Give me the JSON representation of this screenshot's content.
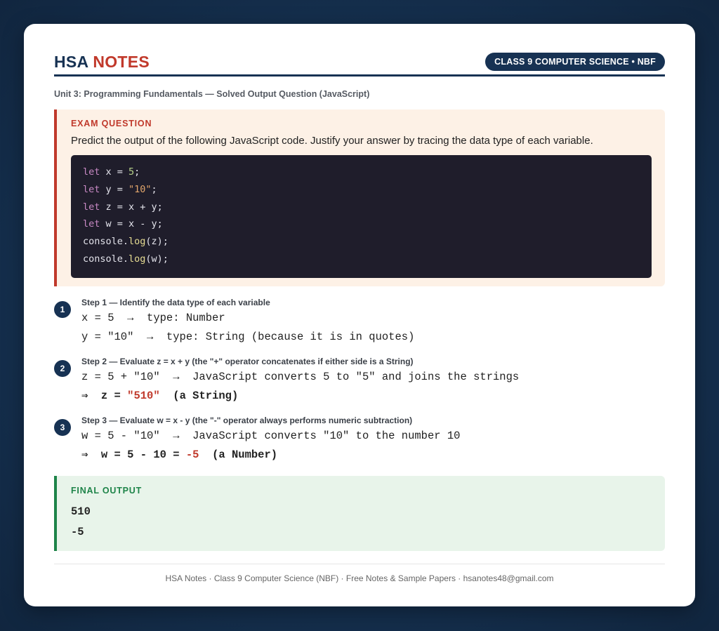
{
  "header": {
    "brand_part1": "HSA",
    "brand_part2": "NOTES",
    "badge": "CLASS 9 COMPUTER SCIENCE • NBF"
  },
  "subtitle": "Unit 3: Programming Fundamentals — Solved Output Question (JavaScript)",
  "question": {
    "label": "EXAM QUESTION",
    "text": "Predict the output of the following JavaScript code. Justify your answer by tracing the data type of each variable.",
    "code": [
      "let x = 5;",
      "let y = \"10\";",
      "let z = x + y;",
      "let w = x - y;",
      "console.log(z);",
      "console.log(w);"
    ]
  },
  "steps": [
    {
      "number": "1",
      "title": "Step 1 — Identify the data type of each variable",
      "line1": "x = 5  →  type: Number",
      "line2": "y = \"10\"  →  type: String (because it is in quotes)"
    },
    {
      "number": "2",
      "title": "Step 2 — Evaluate z = x + y (the \"+\" operator concatenates if either side is a String)",
      "line1": "z = 5 + \"10\"  →  JavaScript converts 5 to \"5\" and joins the strings",
      "result_prefix": "⇒  z = ",
      "result_value": "\"510\"",
      "result_suffix": "  (a String)"
    },
    {
      "number": "3",
      "title": "Step 3 — Evaluate w = x - y (the \"-\" operator always performs numeric subtraction)",
      "line1": "w = 5 - \"10\"  →  JavaScript converts \"10\" to the number 10",
      "result_prefix": "⇒  w = 5 - 10 = ",
      "result_value": "-5",
      "result_suffix": "  (a Number)"
    }
  ],
  "final": {
    "label": "FINAL OUTPUT",
    "values": [
      "510",
      "-5"
    ]
  },
  "footer": "HSA Notes · Class 9 Computer Science (NBF) · Free Notes & Sample Papers · hsanotes48@gmail.com",
  "colors": {
    "navy": "#173253",
    "accent_red": "#c0392b",
    "accent_green": "#1e8449"
  }
}
